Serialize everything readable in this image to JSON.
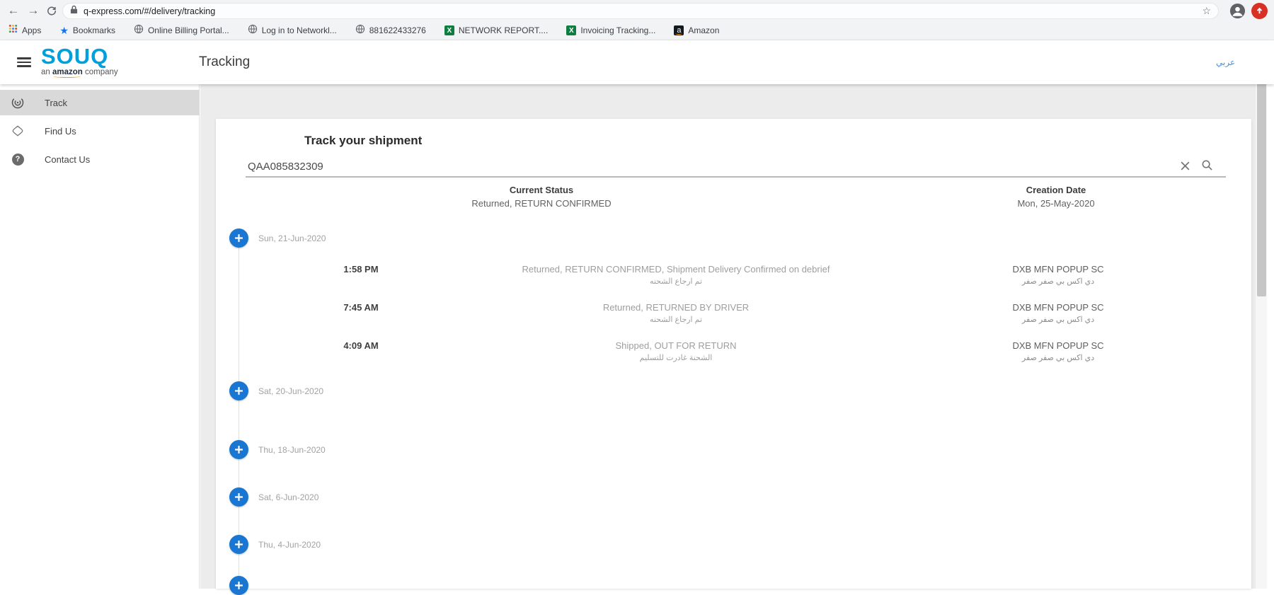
{
  "browser": {
    "url": "q-express.com/#/delivery/tracking",
    "bookmarks_bar": {
      "apps_label": "Apps",
      "bookmarks_label": "Bookmarks",
      "items": [
        {
          "icon": "globe-icon",
          "label": "Online Billing Portal..."
        },
        {
          "icon": "globe-icon",
          "label": "Log in to Networkl..."
        },
        {
          "icon": "globe-icon",
          "label": "881622433276"
        },
        {
          "icon": "excel-icon",
          "label": "NETWORK REPORT...."
        },
        {
          "icon": "excel-icon",
          "label": "Invoicing Tracking..."
        },
        {
          "icon": "amazon-icon",
          "label": "Amazon"
        }
      ]
    }
  },
  "header": {
    "logo_text": "SOUQ",
    "logo_sub_prefix": "an ",
    "logo_sub_brand": "amazon",
    "logo_sub_suffix": " company",
    "page_title": "Tracking",
    "language_link": "عربي"
  },
  "sidebar": {
    "items": [
      {
        "icon": "track-icon",
        "label": "Track",
        "active": true
      },
      {
        "icon": "find-us-icon",
        "label": "Find Us",
        "active": false
      },
      {
        "icon": "contact-us-icon",
        "label": "Contact Us",
        "active": false
      }
    ]
  },
  "tracking": {
    "heading": "Track your shipment",
    "search_value": "QAA085832309",
    "current_status_label": "Current Status",
    "current_status_value": "Returned, RETURN CONFIRMED",
    "creation_date_label": "Creation Date",
    "creation_date_value": "Mon, 25-May-2020",
    "timeline": [
      {
        "date": "Sun, 21-Jun-2020",
        "events": [
          {
            "time": "1:58 PM",
            "status": "Returned, RETURN CONFIRMED, Shipment Delivery Confirmed on debrief",
            "status_ar": "تم ارجاع الشحنه",
            "location": "DXB MFN POPUP SC",
            "location_ar": "دي اكس بي صفر صفر"
          },
          {
            "time": "7:45 AM",
            "status": "Returned, RETURNED BY DRIVER",
            "status_ar": "تم ارجاع الشحنه",
            "location": "DXB MFN POPUP SC",
            "location_ar": "دي اكس بي صفر صفر"
          },
          {
            "time": "4:09 AM",
            "status": "Shipped, OUT FOR RETURN",
            "status_ar": "الشحنة غادرت للتسليم",
            "location": "DXB MFN POPUP SC",
            "location_ar": "دي اكس بي صفر صفر"
          }
        ]
      },
      {
        "date": "Sat, 20-Jun-2020",
        "events": []
      },
      {
        "date": "Thu, 18-Jun-2020",
        "events": []
      },
      {
        "date": "Sat, 6-Jun-2020",
        "events": []
      },
      {
        "date": "Thu, 4-Jun-2020",
        "events": []
      }
    ]
  },
  "colors": {
    "brand_blue": "#00a0dc",
    "plus_button_blue": "#1976d2",
    "amazon_orange": "#ff9900",
    "update_badge_red": "#d93025",
    "active_item_gray": "#d9d9d9"
  }
}
